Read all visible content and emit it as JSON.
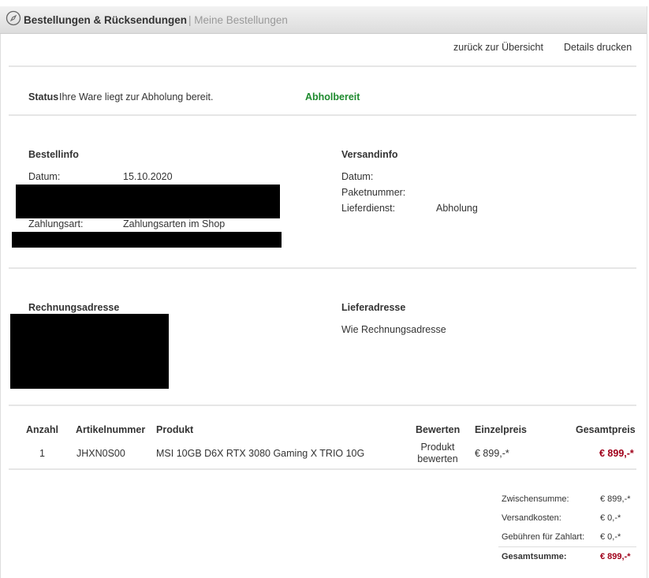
{
  "header": {
    "title": "Bestellungen & Rücksendungen",
    "breadcrumb": "| Meine Bestellungen",
    "icon": "compass-icon"
  },
  "actions": {
    "back": "zurück zur Übersicht",
    "print": "Details drucken"
  },
  "status": {
    "label": "Status",
    "text": "Ihre Ware liegt zur Abholung bereit.",
    "value": "Abholbereit",
    "color": "#1e8a2e"
  },
  "bestellinfo": {
    "title": "Bestellinfo",
    "datum_label": "Datum:",
    "datum": "15.10.2020",
    "zahlungsart_label": "Zahlungsart:",
    "zahlungsart": "Zahlungsarten im Shop"
  },
  "versandinfo": {
    "title": "Versandinfo",
    "datum_label": "Datum:",
    "paket_label": "Paketnummer:",
    "lieferdienst_label": "Lieferdienst:",
    "lieferdienst": "Abholung"
  },
  "rechnungsadresse": {
    "title": "Rechnungsadresse"
  },
  "lieferadresse": {
    "title": "Lieferadresse",
    "text": "Wie Rechnungsadresse"
  },
  "table": {
    "headers": [
      "Anzahl",
      "Artikelnummer",
      "Produkt",
      "Bewerten",
      "Einzelpreis",
      "Gesamtpreis"
    ],
    "rows": [
      {
        "anzahl": "1",
        "artikel": "JHXN0S00",
        "produkt": "MSI 10GB D6X RTX 3080 Gaming X TRIO 10G",
        "bewerten1": "Produkt",
        "bewerten2": "bewerten",
        "einzel": "€ 899,-*",
        "gesamt": "€ 899,-*"
      }
    ]
  },
  "totals": {
    "zwischen_label": "Zwischensumme:",
    "zwischen": "€ 899,-*",
    "versand_label": "Versandkosten:",
    "versand": "€ 0,-*",
    "gebuehr_label": "Gebühren für Zahlart:",
    "gebuehr": "€ 0,-*",
    "gesamt_label": "Gesamtsumme:",
    "gesamt": "€ 899,-*",
    "accent": "#a0001a"
  }
}
